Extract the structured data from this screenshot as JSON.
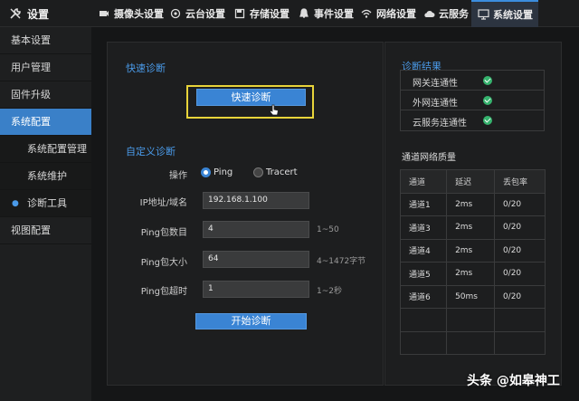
{
  "topbar": {
    "title": "设置",
    "tabs": [
      {
        "label": "摄像头设置",
        "icon": "camera-icon"
      },
      {
        "label": "云台设置",
        "icon": "ptz-icon"
      },
      {
        "label": "存储设置",
        "icon": "storage-icon"
      },
      {
        "label": "事件设置",
        "icon": "event-icon"
      },
      {
        "label": "网络设置",
        "icon": "wifi-icon"
      },
      {
        "label": "云服务",
        "icon": "cloud-icon"
      },
      {
        "label": "系统设置",
        "icon": "monitor-icon"
      }
    ],
    "active_tab": "系统设置"
  },
  "sidebar": {
    "items": [
      {
        "label": "基本设置"
      },
      {
        "label": "用户管理"
      },
      {
        "label": "固件升级"
      },
      {
        "label": "系统配置"
      },
      {
        "label": "系统配置管理"
      },
      {
        "label": "系统维护"
      },
      {
        "label": "诊断工具"
      },
      {
        "label": "视图配置"
      }
    ],
    "active": "系统配置"
  },
  "quick": {
    "title": "快速诊断",
    "button": "快速诊断"
  },
  "custom": {
    "title": "自定义诊断",
    "op_label": "操作",
    "opt1": "Ping",
    "opt2": "Tracert",
    "selected": "Ping",
    "fields": [
      {
        "label": "IP地址/域名",
        "value": "192.168.1.100",
        "hint": ""
      },
      {
        "label": "Ping包数目",
        "value": "4",
        "hint": "1~50"
      },
      {
        "label": "Ping包大小",
        "value": "64",
        "hint": "4~1472字节"
      },
      {
        "label": "Ping包超时",
        "value": "1",
        "hint": "1~2秒"
      }
    ],
    "start_button": "开始诊断"
  },
  "result": {
    "title": "诊断结果",
    "rows": [
      {
        "label": "网关连通性"
      },
      {
        "label": "外网连通性"
      },
      {
        "label": "云服务连通性"
      }
    ],
    "ok_color": "#36b36e"
  },
  "quality": {
    "title": "通道网络质量",
    "headers": [
      "通道",
      "延迟",
      "丢包率"
    ],
    "rows": [
      [
        "通道1",
        "2ms",
        "0/20"
      ],
      [
        "通道3",
        "2ms",
        "0/20"
      ],
      [
        "通道4",
        "2ms",
        "0/20"
      ],
      [
        "通道5",
        "2ms",
        "0/20"
      ],
      [
        "通道6",
        "50ms",
        "0/20"
      ],
      [
        "",
        "",
        ""
      ],
      [
        "",
        "",
        ""
      ]
    ]
  },
  "watermark": "头条 @如皋神工",
  "accent": "#3a84d4"
}
